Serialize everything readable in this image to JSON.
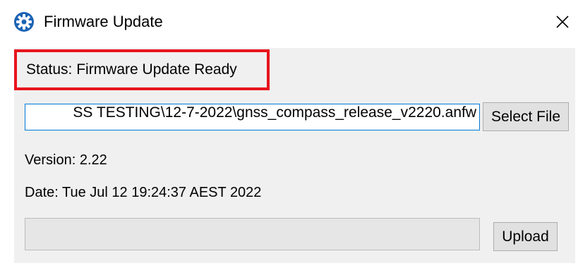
{
  "window": {
    "title": "Firmware Update",
    "app_icon": "settings-gear-icon",
    "close_icon": "close-icon"
  },
  "status": {
    "label": "Status: Firmware Update Ready",
    "highlight_color": "#e8141c"
  },
  "file": {
    "path_visible": "SS TESTING\\12-7-2022\\gnss_compass_release_v2220.anfw",
    "select_button_label": "Select File"
  },
  "firmware": {
    "version_label": "Version: 2.22",
    "date_label": "Date: Tue Jul 12 19:24:37 AEST 2022"
  },
  "upload": {
    "progress_fraction": 0,
    "button_label": "Upload"
  },
  "colors": {
    "accent": "#0078d7",
    "panel_background": "#f0f0f0",
    "app_icon_blue": "#1c64b4"
  }
}
